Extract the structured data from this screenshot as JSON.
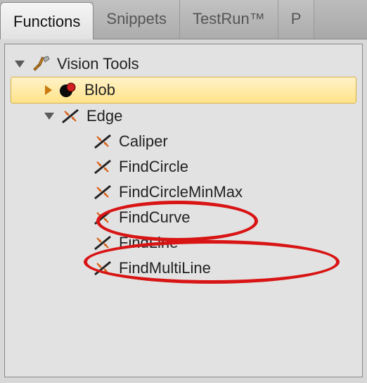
{
  "tabs": {
    "functions": "Functions",
    "snippets": "Snippets",
    "testrun": "TestRun™",
    "p": "P"
  },
  "tree": {
    "root": {
      "label": "Vision Tools"
    },
    "blob": {
      "label": "Blob"
    },
    "edge": {
      "label": "Edge"
    },
    "children": {
      "caliper": "Caliper",
      "findcircle": "FindCircle",
      "findcircleminmax": "FindCircleMinMax",
      "findcurve": "FindCurve",
      "findline": "FindLine",
      "findmultiline": "FindMultiLine"
    }
  }
}
